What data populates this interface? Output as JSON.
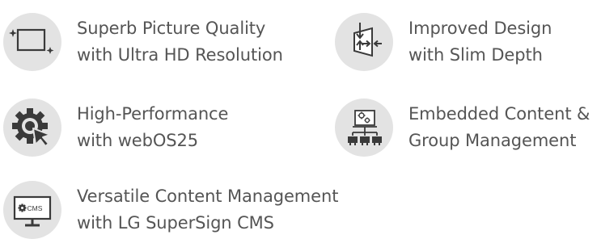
{
  "features": [
    {
      "icon": "display-quality-icon",
      "line1": "Superb Picture Quality",
      "line2": "with Ultra HD Resolution"
    },
    {
      "icon": "slim-depth-icon",
      "line1": "Improved Design",
      "line2": "with Slim Depth"
    },
    {
      "icon": "gear-cursor-icon",
      "line1": "High-Performance",
      "line2": "with webOS25"
    },
    {
      "icon": "group-management-icon",
      "line1": "Embedded Content &",
      "line2": "Group Management"
    },
    {
      "icon": "cms-monitor-icon",
      "line1": "Versatile Content Management",
      "line2": "with LG SuperSign CMS",
      "icon_label": "CMS"
    }
  ],
  "colors": {
    "text": "#555555",
    "icon_circle": "#e3e3e3",
    "icon_stroke": "#3a3a3a"
  }
}
